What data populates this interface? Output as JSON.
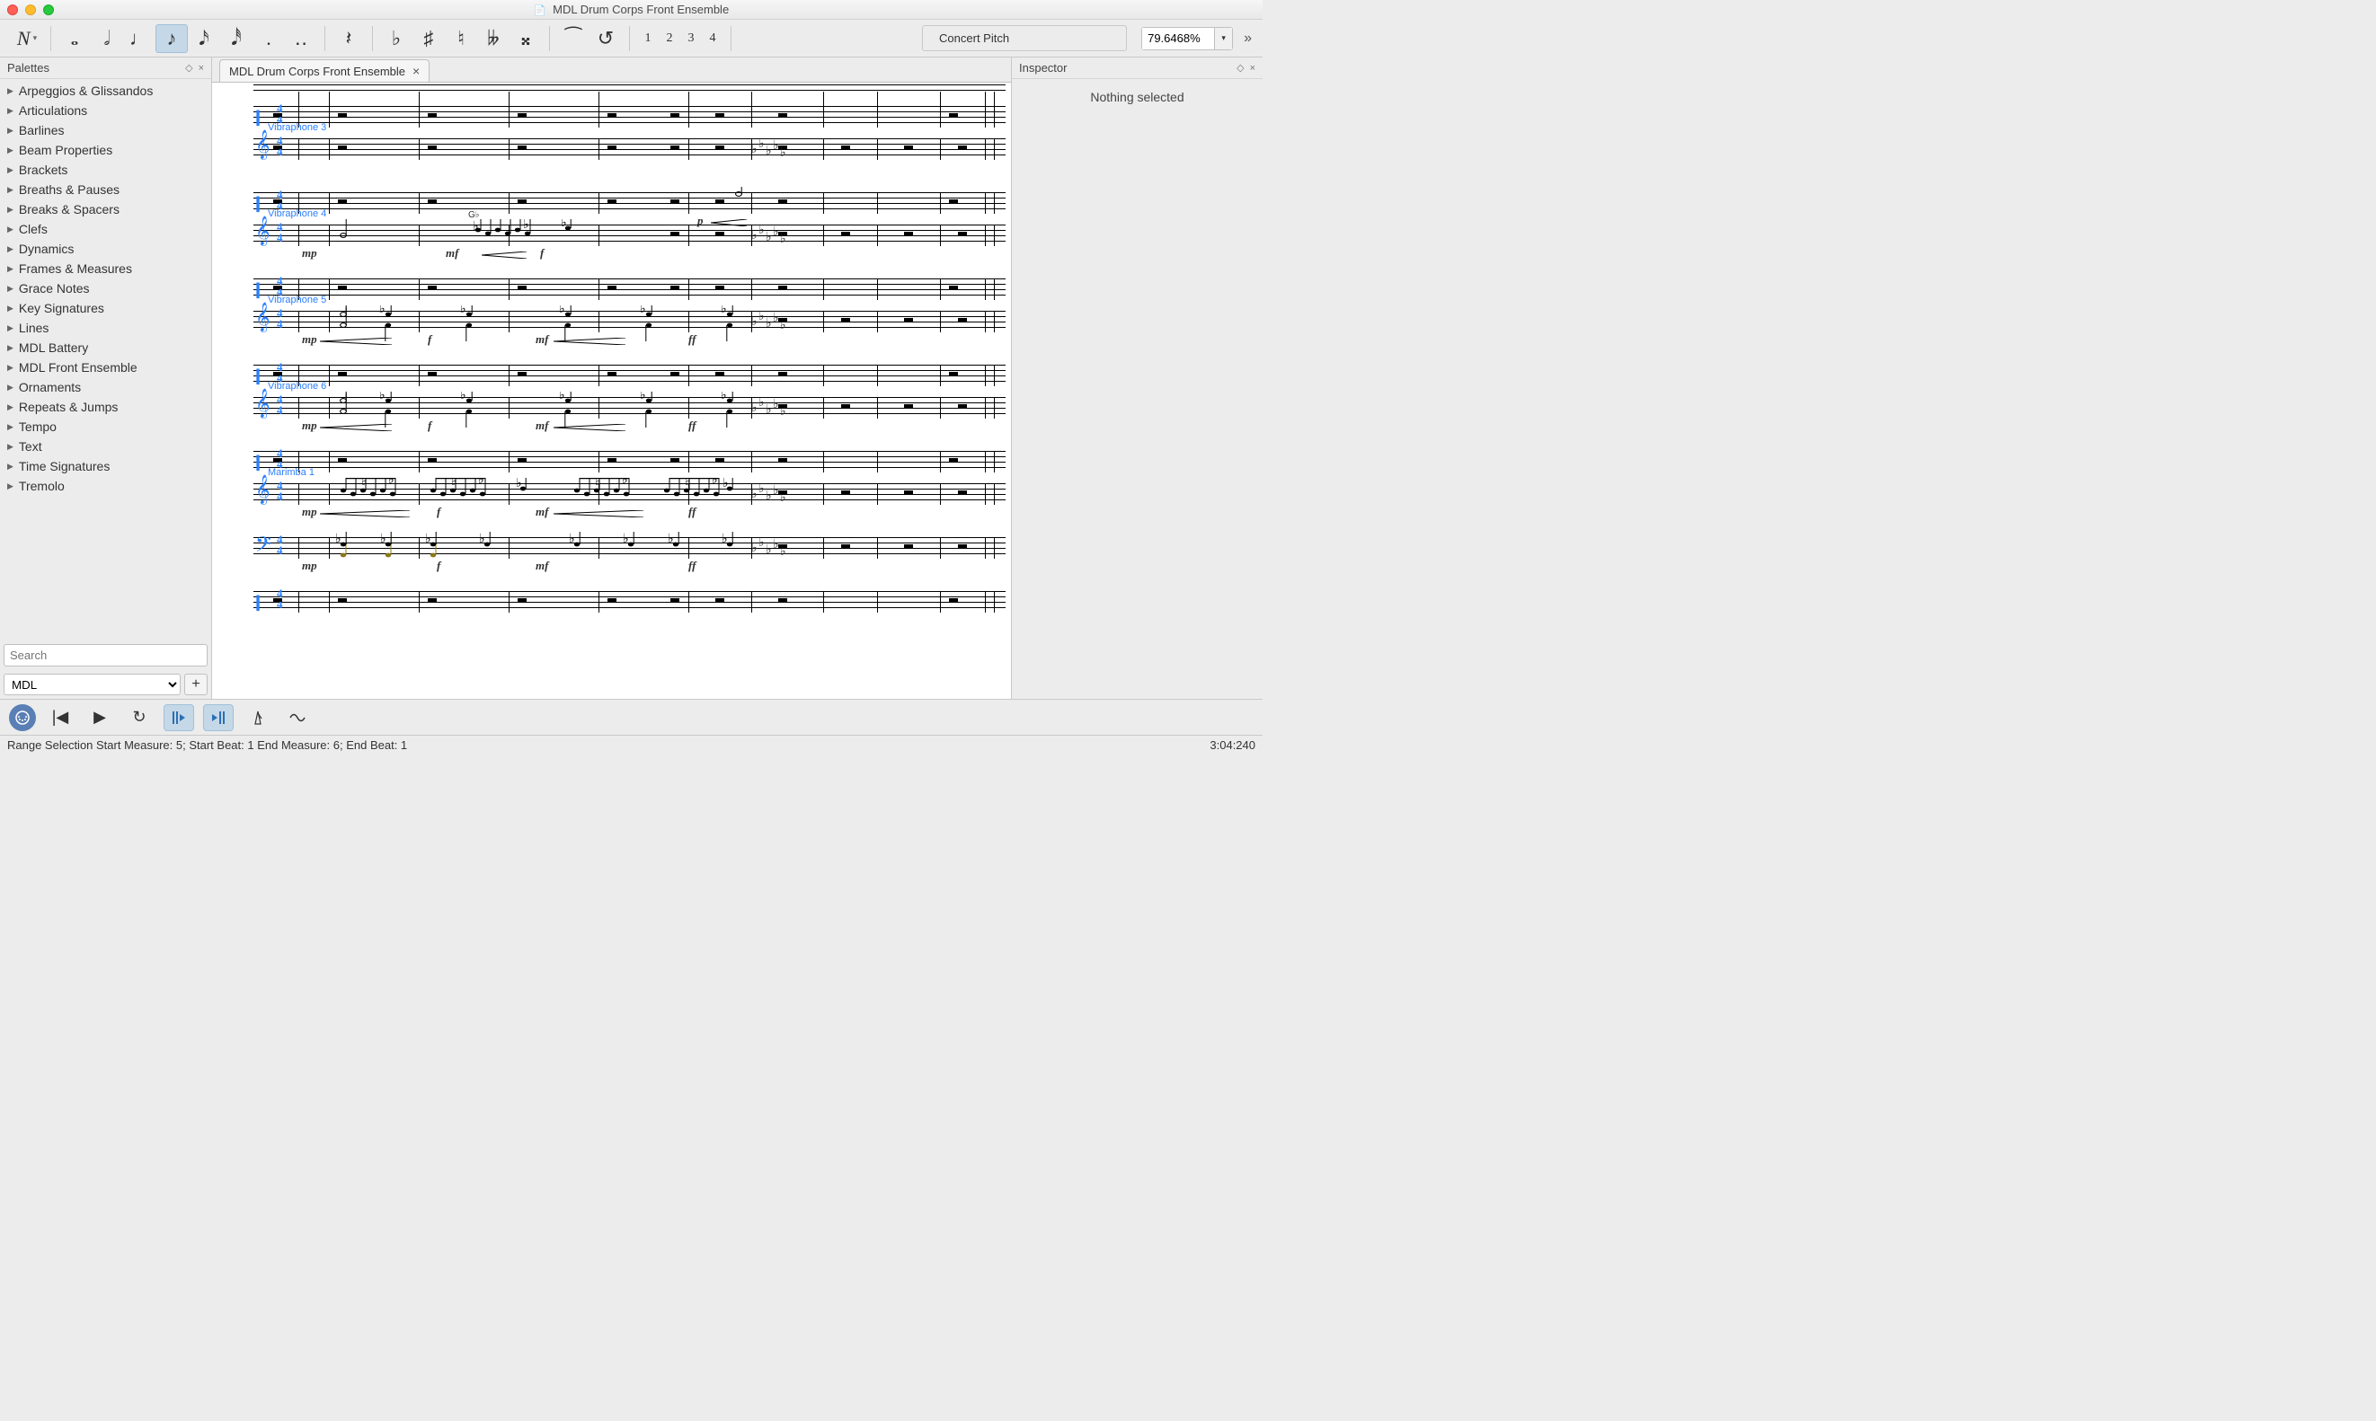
{
  "window": {
    "title": "MDL Drum Corps Front Ensemble"
  },
  "toolbar": {
    "note_entry_label": "N",
    "voices": [
      "1",
      "2",
      "3",
      "4"
    ],
    "concert_pitch": "Concert Pitch",
    "zoom_value": "79.6468%"
  },
  "palettes": {
    "header": "Palettes",
    "items": [
      "Arpeggios & Glissandos",
      "Articulations",
      "Barlines",
      "Beam Properties",
      "Brackets",
      "Breaths & Pauses",
      "Breaks & Spacers",
      "Clefs",
      "Dynamics",
      "Frames & Measures",
      "Grace Notes",
      "Key Signatures",
      "Lines",
      "MDL Battery",
      "MDL Front Ensemble",
      "Ornaments",
      "Repeats & Jumps",
      "Tempo",
      "Text",
      "Time Signatures",
      "Tremolo"
    ],
    "search_placeholder": "Search",
    "workspace": "MDL",
    "add_label": "+"
  },
  "tabs": {
    "active": "MDL Drum Corps Front Ensemble"
  },
  "score": {
    "instruments": [
      {
        "label": "",
        "type": "perc",
        "top_ts": "4/4"
      },
      {
        "label": "Vibraphone 3",
        "type": "treble"
      },
      {
        "label": "",
        "type": "perc"
      },
      {
        "label": "Vibraphone 4",
        "type": "treble"
      },
      {
        "label": "",
        "type": "perc"
      },
      {
        "label": "Vibraphone 5",
        "type": "treble"
      },
      {
        "label": "",
        "type": "perc"
      },
      {
        "label": "Vibraphone 6",
        "type": "treble"
      },
      {
        "label": "",
        "type": "perc"
      },
      {
        "label": "Marimba 1",
        "type": "treble"
      },
      {
        "label": "",
        "type": "bass"
      },
      {
        "label": "",
        "type": "perc"
      }
    ],
    "barline_x": [
      96,
      130,
      230,
      330,
      430,
      530,
      600,
      680,
      740,
      810,
      860,
      870
    ],
    "dynamics": {
      "mp": "mp",
      "mf": "mf",
      "f": "f",
      "ff": "ff",
      "p": "p"
    },
    "chord_label": "G♭"
  },
  "inspector": {
    "header": "Inspector",
    "empty": "Nothing selected"
  },
  "status": {
    "left": "Range Selection Start Measure: 5; Start Beat: 1 End Measure: 6; End Beat: 1",
    "right": "3:04:240"
  }
}
